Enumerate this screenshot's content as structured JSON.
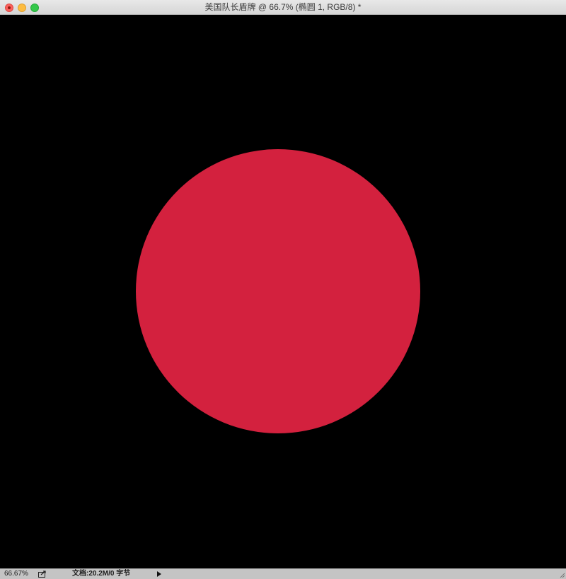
{
  "window": {
    "title": "美国队长盾牌 @ 66.7% (椭圆 1, RGB/8) *"
  },
  "canvas": {
    "background_color": "#000000",
    "shape": {
      "type": "ellipse",
      "name": "椭圆 1",
      "color": "#d3213e"
    }
  },
  "statusbar": {
    "zoom": "66.67%",
    "doc_info": "文档:20.2M/0 字节",
    "share_icon": "share-icon",
    "menu_arrow_icon": "triangle-right-icon"
  }
}
